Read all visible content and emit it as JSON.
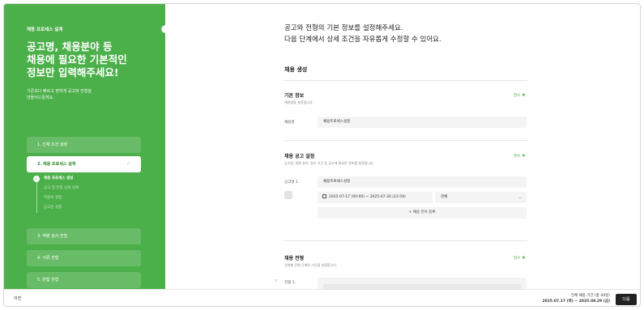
{
  "sidebar": {
    "eyebrow": "채용 프로세스 설계",
    "headline": "공고명, 채용분야 등\n채용에 필요한 기본적인\n정보만 입력해주세요!",
    "subtext": "기존보다 빠르고 편하게 공고와 전형을\n만들어드릴게요.",
    "steps": [
      {
        "label": "1. 인재 조건 설정"
      },
      {
        "label": "2. 채용 프로세스 설계",
        "check": "✓"
      },
      {
        "label": "3. 역량 검사 전형"
      },
      {
        "label": "4. 서류 전형"
      },
      {
        "label": "5. 면접 전형"
      }
    ],
    "substeps": [
      {
        "label": "채용 프로세스 생성"
      },
      {
        "label": "공고 및 전형 상세 설계"
      },
      {
        "label": "지원서 설정"
      },
      {
        "label": "공고문 설정"
      }
    ]
  },
  "main": {
    "intro": "공고와 전형의 기본 정보를 설정해주세요.\n다음 단계에서 상세 조건을 자유롭게 수정할 수 있어요.",
    "section_title": "채용 생성",
    "basic": {
      "title": "기본 정보",
      "desc": "채용명을 설정합니다.",
      "required": "필수",
      "field_label": "채용명",
      "field_value": "채용프로세스설정"
    },
    "posting": {
      "title": "채용 공고 설정",
      "desc": "공고명, 채용 분야, 접수 기간 등 공고에 필요한 정보를 설정합니다.",
      "required": "필수",
      "row_label": "공고명 1.",
      "title_value": "채용프로세스설정",
      "date_value": "2025-07-17 (00:00) ~ 2025-07-30 (23:59)",
      "type_value": "경채",
      "add_label": "+ 채용 분야 등록"
    },
    "phase": {
      "title": "채용 전형",
      "desc": "전형별 진행 단계와 기간을 설정합니다.",
      "required": "필수",
      "qmark": "?",
      "row_label": "전형 1."
    }
  },
  "footer": {
    "prev_label": "이전",
    "period_title": "전체 채용 기간 (총 44일)",
    "period_value": "2025.07.17 (목) ~ 2025.08.29 (금)",
    "next_label": "다음"
  },
  "colors": {
    "accent": "#4cb04a",
    "button_dark": "#222222"
  }
}
